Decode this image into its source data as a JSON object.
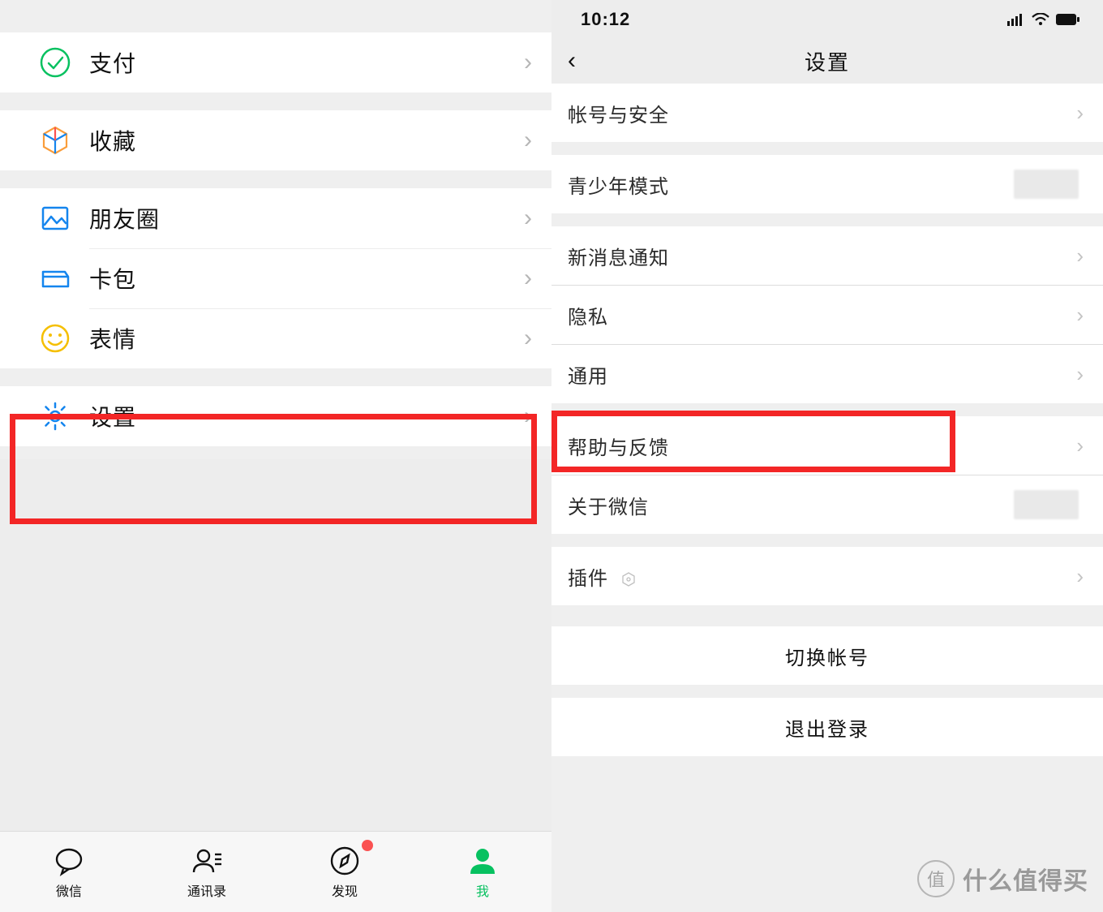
{
  "left_pane": {
    "groups": [
      {
        "rows": [
          {
            "icon": "pay-icon",
            "label": "支付"
          }
        ]
      },
      {
        "rows": [
          {
            "icon": "favorite-icon",
            "label": "收藏"
          }
        ]
      },
      {
        "rows": [
          {
            "icon": "moments-icon",
            "label": "朋友圈"
          },
          {
            "icon": "cards-icon",
            "label": "卡包"
          },
          {
            "icon": "stickers-icon",
            "label": "表情"
          }
        ]
      },
      {
        "rows": [
          {
            "icon": "settings-icon",
            "label": "设置"
          }
        ],
        "highlight": true
      }
    ],
    "tabs": [
      {
        "icon": "chat-icon",
        "label": "微信",
        "active": false,
        "dot": false
      },
      {
        "icon": "contacts-icon",
        "label": "通讯录",
        "active": false,
        "dot": false
      },
      {
        "icon": "discover-icon",
        "label": "发现",
        "active": false,
        "dot": true
      },
      {
        "icon": "me-icon",
        "label": "我",
        "active": true,
        "dot": false
      }
    ]
  },
  "right_pane": {
    "statusbar": {
      "time": "10:12"
    },
    "navbar": {
      "title": "设置"
    },
    "rows": [
      {
        "type": "group",
        "items": [
          {
            "label": "帐号与安全",
            "chev": true
          }
        ]
      },
      {
        "type": "group",
        "items": [
          {
            "label": "青少年模式",
            "blur": true
          }
        ]
      },
      {
        "type": "group",
        "items": [
          {
            "label": "新消息通知",
            "chev": true
          },
          {
            "label": "隐私",
            "chev": true
          },
          {
            "label": "通用",
            "chev": true
          }
        ]
      },
      {
        "type": "group",
        "items": [
          {
            "label": "帮助与反馈",
            "chev": true,
            "highlight": true
          },
          {
            "label": "关于微信",
            "blur": true
          }
        ]
      },
      {
        "type": "group",
        "items": [
          {
            "label": "插件",
            "chev": true,
            "plugin_badge": true
          }
        ]
      },
      {
        "type": "center",
        "label": "切换帐号"
      },
      {
        "type": "center",
        "label": "退出登录"
      }
    ]
  },
  "watermark": {
    "badge": "值",
    "text": "什么值得买"
  },
  "highlight_color": "#f32626"
}
